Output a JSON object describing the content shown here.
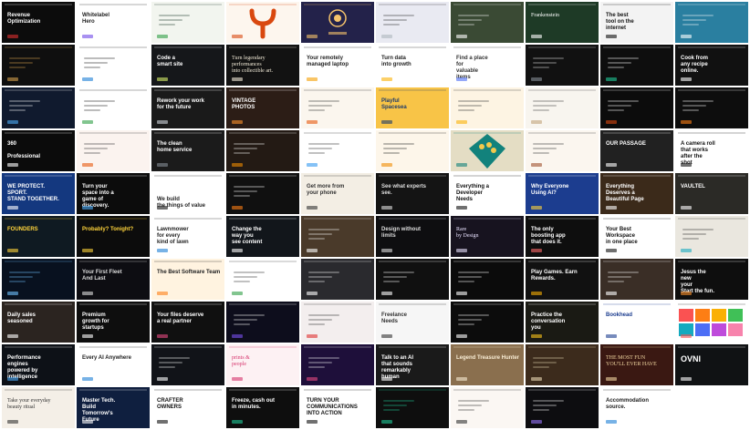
{
  "grid": {
    "columns": 10,
    "rows": 10
  },
  "tiles": [
    {
      "bg": "#0c0c0c",
      "fg": "#ffffff",
      "accent": "#e03131",
      "text": "Revenue\nOptimization"
    },
    {
      "bg": "#ffffff",
      "fg": "#222222",
      "accent": "#7048e8",
      "text": "Whitelabel\nHero"
    },
    {
      "bg": "#f2f5ef",
      "fg": "#1f3d2b",
      "accent": "#2f9e44",
      "text": ""
    },
    {
      "bg": "#fdf6ee",
      "fg": "#d9480f",
      "accent": "#d9480f",
      "text": "",
      "shape": "ypsilon"
    },
    {
      "bg": "#23224a",
      "fg": "#f5c36b",
      "accent": "#f5c36b",
      "text": "",
      "shape": "seal"
    },
    {
      "bg": "#e9eaf2",
      "fg": "#333333",
      "accent": "#adb5bd",
      "text": ""
    },
    {
      "bg": "#3a4a34",
      "fg": "#ffffff",
      "accent": "#ffffff",
      "text": ""
    },
    {
      "bg": "#1e3a26",
      "fg": "#ffffff",
      "accent": "#ffffff",
      "text": "Frankenstein",
      "serif": true
    },
    {
      "bg": "#f3f3f3",
      "fg": "#111111",
      "accent": "#111111",
      "text": "The best\ntool on the\ninternet"
    },
    {
      "bg": "#2a7fa0",
      "fg": "#ffffff",
      "accent": "#ffffff",
      "text": ""
    },
    {
      "bg": "#0f0f0f",
      "fg": "#d4a04c",
      "accent": "#d4a04c",
      "text": ""
    },
    {
      "bg": "#ffffff",
      "fg": "#222222",
      "accent": "#1c7ed6",
      "text": ""
    },
    {
      "bg": "#15171a",
      "fg": "#ffffff",
      "accent": "#d9f26b",
      "text": "Code a\nsmart site"
    },
    {
      "bg": "#121212",
      "fg": "#f1ead7",
      "accent": "#f1ead7",
      "text": "Turn legendary\nperformances\ninto collectible art.",
      "serif": true
    },
    {
      "bg": "#ffffff",
      "fg": "#222222",
      "accent": "#f59f00",
      "text": "Your remotely\nmanaged laptop"
    },
    {
      "bg": "#ffffff",
      "fg": "#222222",
      "accent": "#fab005",
      "text": "Turn data\ninto growth"
    },
    {
      "bg": "#ffffff",
      "fg": "#333333",
      "accent": "#4c6ef5",
      "text": "Find a place\nfor\nvaluable\nitems"
    },
    {
      "bg": "#111111",
      "fg": "#dddddd",
      "accent": "#868e96",
      "text": ""
    },
    {
      "bg": "#0e0e0e",
      "fg": "#ffffff",
      "accent": "#20c997",
      "text": ""
    },
    {
      "bg": "#111111",
      "fg": "#ffffff",
      "accent": "#ffffff",
      "text": "Cook from\nany recipe\nonline."
    },
    {
      "bg": "#101a2e",
      "fg": "#ffffff",
      "accent": "#4dabf7",
      "text": ""
    },
    {
      "bg": "#ffffff",
      "fg": "#222222",
      "accent": "#2f9e44",
      "text": ""
    },
    {
      "bg": "#1a1a1a",
      "fg": "#ffffff",
      "accent": "#ced4da",
      "text": "Rework your work\nfor the future"
    },
    {
      "bg": "#2c1d16",
      "fg": "#ffffff",
      "accent": "#ff922b",
      "text": "VINTAGE\nPHOTOS"
    },
    {
      "bg": "#fbf6ee",
      "fg": "#333333",
      "accent": "#e8590c",
      "text": ""
    },
    {
      "bg": "#f8c447",
      "fg": "#1d3a6b",
      "accent": "#1d3a6b",
      "text": "Playful\nSpacesea"
    },
    {
      "bg": "#fdf4e3",
      "fg": "#333333",
      "accent": "#fab005",
      "text": ""
    },
    {
      "bg": "#f8f5ef",
      "fg": "#444444",
      "accent": "#c2a37a",
      "text": ""
    },
    {
      "bg": "#0c0c0c",
      "fg": "#ffffff",
      "accent": "#d9480f",
      "text": ""
    },
    {
      "bg": "#0d0d0d",
      "fg": "#ffffff",
      "accent": "#fd7e14",
      "text": ""
    },
    {
      "bg": "#0b0b0b",
      "fg": "#ffffff",
      "accent": "#ffffff",
      "text": "360\n\nProfessional"
    },
    {
      "bg": "#fbf3ef",
      "fg": "#333333",
      "accent": "#e8590c",
      "text": ""
    },
    {
      "bg": "#1b1b1b",
      "fg": "#ffffff",
      "accent": "#868e96",
      "text": "The clean\nhome service"
    },
    {
      "bg": "#231a14",
      "fg": "#ffffff",
      "accent": "#f08c00",
      "text": ""
    },
    {
      "bg": "#ffffff",
      "fg": "#333333",
      "accent": "#339af0",
      "text": ""
    },
    {
      "bg": "#fdf6ea",
      "fg": "#222222",
      "accent": "#f08c00",
      "text": ""
    },
    {
      "bg": "#e4ddc4",
      "fg": "#12827c",
      "accent": "#12827c",
      "text": "",
      "shape": "diamond"
    },
    {
      "bg": "#fbf6ef",
      "fg": "#333333",
      "accent": "#a0522d",
      "text": ""
    },
    {
      "bg": "#212121",
      "fg": "#ffffff",
      "accent": "#ffffff",
      "text": "OUR PASSAGE"
    },
    {
      "bg": "#ffffff",
      "fg": "#111111",
      "accent": "#111111",
      "text": "A camera roll\nthat works\nafter the\nshot"
    },
    {
      "bg": "#14387f",
      "fg": "#ffffff",
      "accent": "#ffffff",
      "text": "WE PROTECT.\nSPORT.\nSTAND TOGETHER."
    },
    {
      "bg": "#0c0c0c",
      "fg": "#ffffff",
      "accent": "#4dabf7",
      "text": "Turn your\nspace into a\ngame of\ndiscovery."
    },
    {
      "bg": "#ffffff",
      "fg": "#222222",
      "accent": "#111111",
      "text": "\n\nWe build\nthe things of value"
    },
    {
      "bg": "#101010",
      "fg": "#ffffff",
      "accent": "#fd7e14",
      "text": ""
    },
    {
      "bg": "#f3eee4",
      "fg": "#333333",
      "accent": "#333333",
      "text": "Get more from\nyour phone"
    },
    {
      "bg": "#141414",
      "fg": "#dddddd",
      "accent": "#dddddd",
      "text": "See what experts\nsee."
    },
    {
      "bg": "#ffffff",
      "fg": "#111111",
      "accent": "#111111",
      "text": "Everything a\nDeveloper\nNeeds"
    },
    {
      "bg": "#1c3d8f",
      "fg": "#ffffff",
      "accent": "#ffd43b",
      "text": "Why Everyone\nUsing Ai?"
    },
    {
      "bg": "#3b2a1a",
      "fg": "#ffffff",
      "accent": "#ffffff",
      "text": "Everything\nDeserves a\nBeautiful Page"
    },
    {
      "bg": "#2b2a26",
      "fg": "#ffffff",
      "accent": "#ffffff",
      "text": "VAULTEL"
    },
    {
      "bg": "#0f1a22",
      "fg": "#ffd43b",
      "accent": "#ffd43b",
      "text": "FOUNDERS"
    },
    {
      "bg": "#0c0c0c",
      "fg": "#ffd43b",
      "accent": "#ffd43b",
      "text": "Probably? Tonight?"
    },
    {
      "bg": "#ffffff",
      "fg": "#222222",
      "accent": "#1c7ed6",
      "text": "Lawnmower\nfor every\nkind of lawn"
    },
    {
      "bg": "#12161b",
      "fg": "#ffffff",
      "accent": "#ffffff",
      "text": "Change the\nway you\nsee content"
    },
    {
      "bg": "#4a3a2a",
      "fg": "#ffffff",
      "accent": "#ffffff",
      "text": ""
    },
    {
      "bg": "#0e0e10",
      "fg": "#dddddd",
      "accent": "#dddddd",
      "text": "Design without\nlimits"
    },
    {
      "bg": "#17131f",
      "fg": "#e9e2ff",
      "accent": "#e9e2ff",
      "text": "Rare\nby Design",
      "serif": true
    },
    {
      "bg": "#0e0e0e",
      "fg": "#ffffff",
      "accent": "#ff6b6b",
      "text": "The only\nboosting app\nthat does it."
    },
    {
      "bg": "#ffffff",
      "fg": "#111111",
      "accent": "#111111",
      "text": "Your Best\nWorkspace\nin one place"
    },
    {
      "bg": "#eae7df",
      "fg": "#333333",
      "accent": "#15aabf",
      "text": ""
    },
    {
      "bg": "#08111f",
      "fg": "#6fc3ff",
      "accent": "#6fc3ff",
      "text": ""
    },
    {
      "bg": "#0d0d12",
      "fg": "#dddddd",
      "accent": "#dddddd",
      "text": "Your First Fleet\nAnd Last"
    },
    {
      "bg": "#fff3e0",
      "fg": "#222222",
      "accent": "#fd7e14",
      "text": "The Best Software Team"
    },
    {
      "bg": "#ffffff",
      "fg": "#333333",
      "accent": "#2f9e44",
      "text": ""
    },
    {
      "bg": "#2a2a2e",
      "fg": "#ffffff",
      "accent": "#ffffff",
      "text": ""
    },
    {
      "bg": "#101010",
      "fg": "#ffffff",
      "accent": "#ffffff",
      "text": ""
    },
    {
      "bg": "#0b0b0b",
      "fg": "#ffffff",
      "accent": "#ffffff",
      "text": ""
    },
    {
      "bg": "#111111",
      "fg": "#ffffff",
      "accent": "#fab005",
      "text": "Play Games. Earn\nRewards."
    },
    {
      "bg": "#3a2e26",
      "fg": "#ffffff",
      "accent": "#ffffff",
      "text": ""
    },
    {
      "bg": "#0e0e0e",
      "fg": "#ffffff",
      "accent": "#ff922b",
      "text": "Jesus the\nnew\nyour\nStart the fun."
    },
    {
      "bg": "#2b2420",
      "fg": "#ffffff",
      "accent": "#ffffff",
      "text": "Daily sales\nseasoned"
    },
    {
      "bg": "#0e0e0e",
      "fg": "#ffffff",
      "accent": "#ffffff",
      "text": "Premium\ngrowth for\nstartups"
    },
    {
      "bg": "#101010",
      "fg": "#ffffff",
      "accent": "#e64980",
      "text": "Your files deserve\na real partner"
    },
    {
      "bg": "#0d0d1c",
      "fg": "#ffffff",
      "accent": "#7950f2",
      "text": ""
    },
    {
      "bg": "#f3eeee",
      "fg": "#333333",
      "accent": "#e03131",
      "text": ""
    },
    {
      "bg": "#f6f6f6",
      "fg": "#333333",
      "accent": "#333333",
      "text": "Freelance\nNeeds"
    },
    {
      "bg": "#0c0c0c",
      "fg": "#ffffff",
      "accent": "#ffffff",
      "text": ""
    },
    {
      "bg": "#1a1a14",
      "fg": "#ffffff",
      "accent": "#fcc419",
      "text": "Practice the\nconversation\nyou"
    },
    {
      "bg": "#ffffff",
      "fg": "#1c3d8f",
      "accent": "#1c3d8f",
      "text": "Bookhead"
    },
    {
      "bg": "#ffffff",
      "fg": "#333333",
      "accent": "#fa5252",
      "text": "",
      "shape": "palette"
    },
    {
      "bg": "#0d1117",
      "fg": "#ffffff",
      "accent": "#4dabf7",
      "text": "Performance\nengines\npowered by\nintelligence"
    },
    {
      "bg": "#ffffff",
      "fg": "#222222",
      "accent": "#1c7ed6",
      "text": "Every AI Anywhere"
    },
    {
      "bg": "#111318",
      "fg": "#ffffff",
      "accent": "#ffffff",
      "text": ""
    },
    {
      "bg": "#fdf1f3",
      "fg": "#d6336c",
      "accent": "#d6336c",
      "text": "prints &\npeople",
      "serif": true
    },
    {
      "bg": "#1e0f3a",
      "fg": "#ffffff",
      "accent": "#e64980",
      "text": ""
    },
    {
      "bg": "#1a1a1a",
      "fg": "#ffffff",
      "accent": "#ffffff",
      "text": "Talk to an AI\nthat sounds\nremarkably\nhuman"
    },
    {
      "bg": "#8a6f4e",
      "fg": "#f8ecd4",
      "accent": "#f8ecd4",
      "text": "Legend Treasure Hunter"
    },
    {
      "bg": "#3c2b1c",
      "fg": "#e9d8b4",
      "accent": "#e9d8b4",
      "text": ""
    },
    {
      "bg": "#3a1812",
      "fg": "#f1d6a0",
      "accent": "#f1d6a0",
      "text": "THE MOST FUN\nYOU'LL EVER HAVE",
      "serif": true
    },
    {
      "bg": "#101214",
      "fg": "#ffffff",
      "accent": "#ffffff",
      "text": "OVNI",
      "big": true
    },
    {
      "bg": "#f4efe7",
      "fg": "#333333",
      "accent": "#333333",
      "text": "Take your everyday\nbeauty ritual",
      "serif": true
    },
    {
      "bg": "#0f1f3f",
      "fg": "#ffffff",
      "accent": "#ffffff",
      "text": "Master Tech.\nBuild\nTomorrow's\nFuture"
    },
    {
      "bg": "#ffffff",
      "fg": "#111111",
      "accent": "#111111",
      "text": "CRAFTER\nOWNERS"
    },
    {
      "bg": "#0e0e0e",
      "fg": "#ffffff",
      "accent": "#20c997",
      "text": "Freeze, cash out\nin minutes."
    },
    {
      "bg": "#ffffff",
      "fg": "#111111",
      "accent": "#111111",
      "text": "TURN YOUR\nCOMMUNICATIONS\nINTO ACTION"
    },
    {
      "bg": "#0e0e0e",
      "fg": "#20c997",
      "accent": "#20c997",
      "text": ""
    },
    {
      "bg": "#fbf7f3",
      "fg": "#333333",
      "accent": "#333333",
      "text": ""
    },
    {
      "bg": "#0d0d10",
      "fg": "#ffffff",
      "accent": "#9775fa",
      "text": ""
    },
    {
      "bg": "#ffffff",
      "fg": "#222222",
      "accent": "#1c7ed6",
      "text": "Accommodation\nsource."
    },
    {
      "bg": "#ffffff",
      "fg": "#ffffff",
      "accent": "#ffffff",
      "text": ""
    }
  ]
}
